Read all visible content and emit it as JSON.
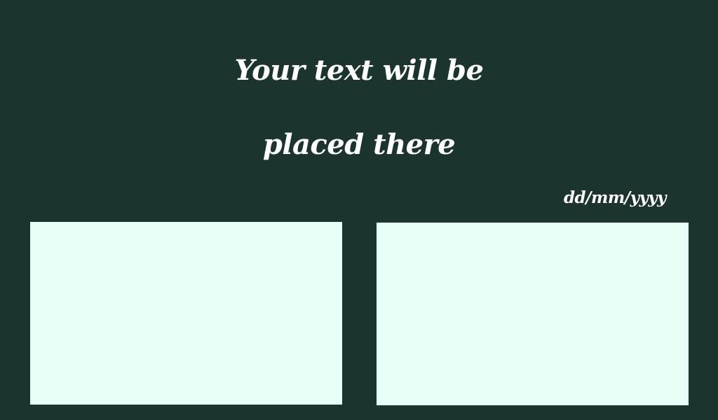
{
  "headline": {
    "line1": "Your text will be",
    "line2": "placed there"
  },
  "date": {
    "placeholder": "dd/mm/yyyy"
  },
  "colors": {
    "background": "#1b342d",
    "text": "#ffffff",
    "panel": "#e8fff8"
  }
}
